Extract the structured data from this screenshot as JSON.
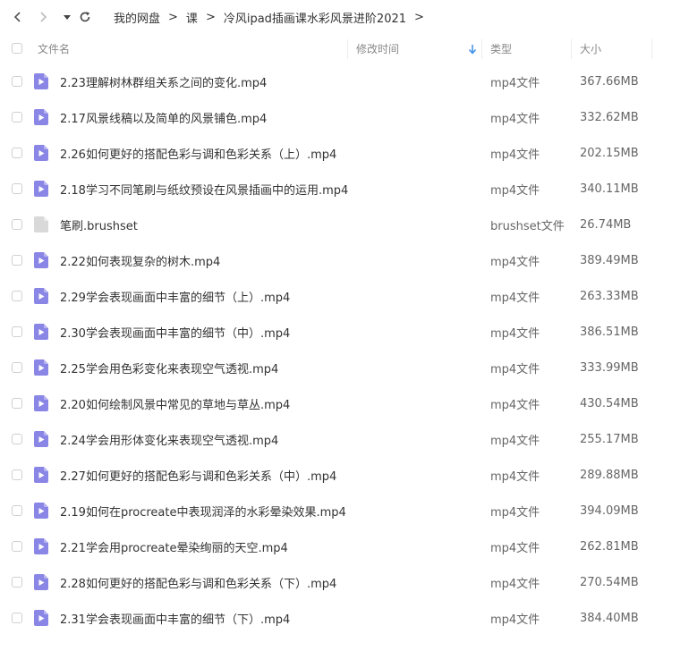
{
  "breadcrumb": {
    "items": [
      "我的网盘",
      "课",
      "冷风ipad插画课水彩风景进阶2021"
    ],
    "separator": ">"
  },
  "header": {
    "col_name": "文件名",
    "col_modified": "修改时间",
    "col_type": "类型",
    "col_size": "大小"
  },
  "colors": {
    "video_icon": "#8a86e6",
    "generic_icon": "#d9d9d9",
    "sort_arrow": "#3a8ee6"
  },
  "files": [
    {
      "name": "2.23理解树林群组关系之间的变化.mp4",
      "type": "mp4文件",
      "size": "367.66MB",
      "icon": "video-file-icon"
    },
    {
      "name": "2.17风景线稿以及简单的风景铺色.mp4",
      "type": "mp4文件",
      "size": "332.62MB",
      "icon": "video-file-icon"
    },
    {
      "name": "2.26如何更好的搭配色彩与调和色彩关系（上）.mp4",
      "type": "mp4文件",
      "size": "202.15MB",
      "icon": "video-file-icon"
    },
    {
      "name": "2.18学习不同笔刷与纸纹预设在风景插画中的运用.mp4",
      "type": "mp4文件",
      "size": "340.11MB",
      "icon": "video-file-icon"
    },
    {
      "name": "笔刷.brushset",
      "type": "brushset文件",
      "size": "26.74MB",
      "icon": "generic-file-icon"
    },
    {
      "name": "2.22如何表现复杂的树木.mp4",
      "type": "mp4文件",
      "size": "389.49MB",
      "icon": "video-file-icon"
    },
    {
      "name": "2.29学会表现画面中丰富的细节（上）.mp4",
      "type": "mp4文件",
      "size": "263.33MB",
      "icon": "video-file-icon"
    },
    {
      "name": "2.30学会表现画面中丰富的细节（中）.mp4",
      "type": "mp4文件",
      "size": "386.51MB",
      "icon": "video-file-icon"
    },
    {
      "name": "2.25学会用色彩变化来表现空气透视.mp4",
      "type": "mp4文件",
      "size": "333.99MB",
      "icon": "video-file-icon"
    },
    {
      "name": "2.20如何绘制风景中常见的草地与草丛.mp4",
      "type": "mp4文件",
      "size": "430.54MB",
      "icon": "video-file-icon"
    },
    {
      "name": "2.24学会用形体变化来表现空气透视.mp4",
      "type": "mp4文件",
      "size": "255.17MB",
      "icon": "video-file-icon"
    },
    {
      "name": "2.27如何更好的搭配色彩与调和色彩关系（中）.mp4",
      "type": "mp4文件",
      "size": "289.88MB",
      "icon": "video-file-icon"
    },
    {
      "name": "2.19如何在procreate中表现润泽的水彩晕染效果.mp4",
      "type": "mp4文件",
      "size": "394.09MB",
      "icon": "video-file-icon"
    },
    {
      "name": "2.21学会用procreate晕染绚丽的天空.mp4",
      "type": "mp4文件",
      "size": "262.81MB",
      "icon": "video-file-icon"
    },
    {
      "name": "2.28如何更好的搭配色彩与调和色彩关系（下）.mp4",
      "type": "mp4文件",
      "size": "270.54MB",
      "icon": "video-file-icon"
    },
    {
      "name": "2.31学会表现画面中丰富的细节（下）.mp4",
      "type": "mp4文件",
      "size": "384.40MB",
      "icon": "video-file-icon"
    }
  ]
}
